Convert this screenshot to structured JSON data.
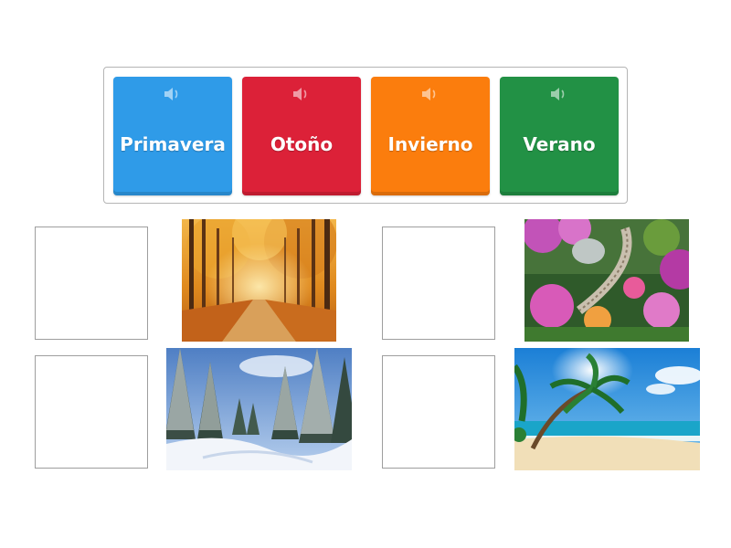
{
  "cards": [
    {
      "id": "primavera",
      "label": "Primavera",
      "color": "#2f9be8",
      "icon": "speaker-icon"
    },
    {
      "id": "otono",
      "label": "Otoño",
      "color": "#dc2138",
      "icon": "speaker-icon"
    },
    {
      "id": "invierno",
      "label": "Invierno",
      "color": "#fb7d0d",
      "icon": "speaker-icon"
    },
    {
      "id": "verano",
      "label": "Verano",
      "color": "#229145",
      "icon": "speaker-icon"
    }
  ],
  "drop_zones": [
    {
      "id": "drop-autumn",
      "content": ""
    },
    {
      "id": "drop-spring",
      "content": ""
    },
    {
      "id": "drop-winter",
      "content": ""
    },
    {
      "id": "drop-summer",
      "content": ""
    }
  ],
  "images": [
    {
      "id": "autumn-forest",
      "depicts": "autumn forest path"
    },
    {
      "id": "spring-garden",
      "depicts": "flower garden staircase"
    },
    {
      "id": "winter-forest",
      "depicts": "snowy pine forest"
    },
    {
      "id": "summer-beach",
      "depicts": "tropical beach palm"
    }
  ]
}
